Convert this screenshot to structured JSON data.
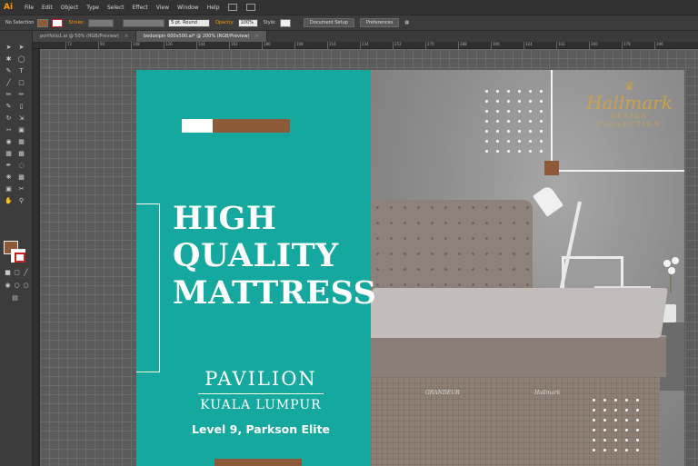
{
  "app": {
    "logo": "Ai",
    "menu": [
      "File",
      "Edit",
      "Object",
      "Type",
      "Select",
      "Effect",
      "View",
      "Window",
      "Help"
    ]
  },
  "control_bar": {
    "selection": "No Selection",
    "stroke_label": "Stroke:",
    "brush": "5 pt. Round",
    "opacity_label": "Opacity:",
    "opacity_value": "100%",
    "style_label": "Style:",
    "document_setup": "Document Setup",
    "preferences": "Preferences"
  },
  "tabs": [
    {
      "label": "portfolio1.ai @ 50% (RGB/Preview)",
      "active": false
    },
    {
      "label": "bedoxipin 600x500.ai* @ 200% (RGB/Preview)",
      "active": true
    }
  ],
  "ruler": {
    "ticks": [
      "72",
      "90",
      "108",
      "126",
      "144",
      "162",
      "180",
      "198",
      "216",
      "234",
      "252",
      "270",
      "288",
      "306",
      "324",
      "342",
      "360",
      "378",
      "396"
    ]
  },
  "colors": {
    "teal": "#15a89e",
    "brown": "#8c5a36",
    "gold": "#c9a24b"
  },
  "artboard": {
    "headline": [
      "HIGH",
      "QUALITY",
      "MATTRESS"
    ],
    "venue_name": "PAVILION",
    "venue_city": "KUALA LUMPUR",
    "venue_level": "Level 9, Parkson Elite",
    "logo_word": "Hallmark",
    "logo_sub_1": "DESIGN",
    "logo_sub_2": "COLLECTION",
    "base_label_1": "GRANDEUR",
    "base_label_2": "Hallmark"
  }
}
